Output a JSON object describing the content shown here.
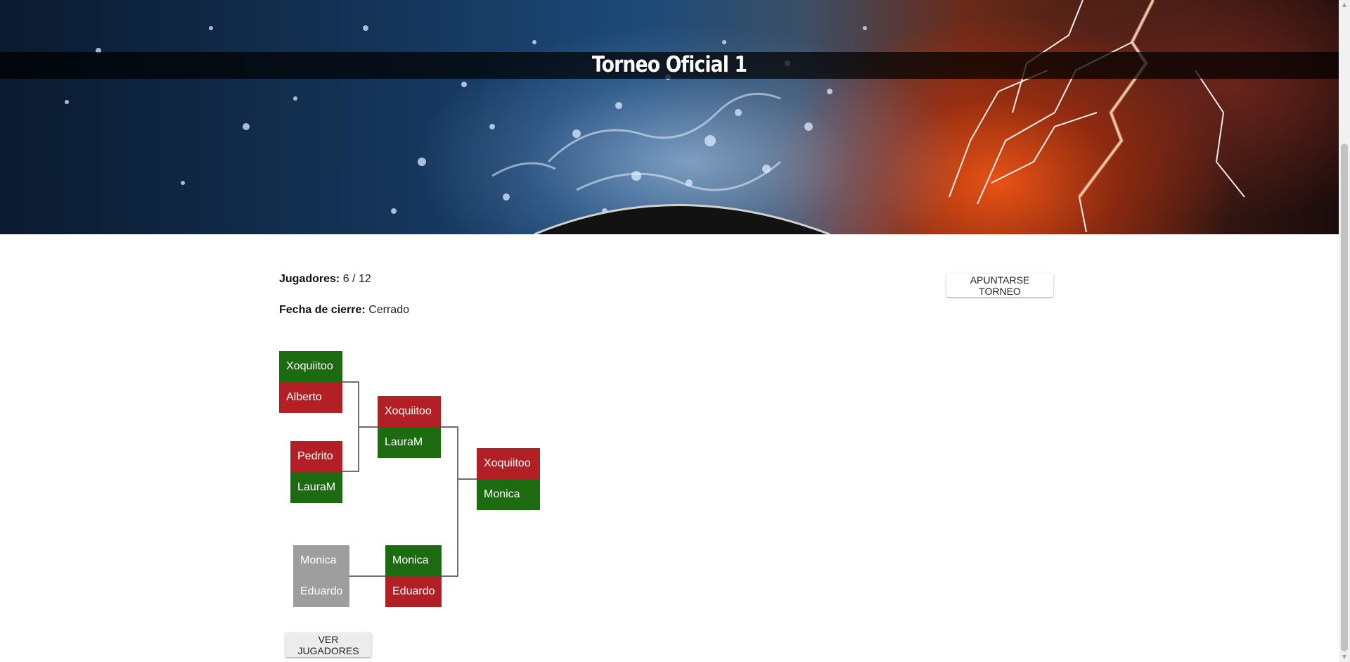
{
  "tournament": {
    "title": "Torneo Oficial 1"
  },
  "info": {
    "players_label": "Jugadores:",
    "players_value": "6 / 12",
    "close_label": "Fecha de cierre:",
    "close_value": "Cerrado"
  },
  "buttons": {
    "join_label": "APUNTARSE TORNEO",
    "view_players_label": "VER JUGADORES"
  },
  "colors": {
    "winner": "#1d6b11",
    "loser": "#b22025",
    "bye": "#9e9e9e"
  },
  "bracket": {
    "round1": [
      {
        "p1": {
          "name": "Xoquiitoo",
          "status": "win"
        },
        "p2": {
          "name": "Alberto",
          "status": "lose"
        }
      },
      {
        "p1": {
          "name": "Pedrito",
          "status": "lose"
        },
        "p2": {
          "name": "LauraM",
          "status": "win"
        }
      },
      {
        "p1": {
          "name": "Monica",
          "status": "bye"
        },
        "p2": {
          "name": "Eduardo",
          "status": "bye"
        }
      }
    ],
    "round2": [
      {
        "p1": {
          "name": "Xoquiitoo",
          "status": "lose"
        },
        "p2": {
          "name": "LauraM",
          "status": "win"
        }
      },
      {
        "p1": {
          "name": "Monica",
          "status": "win"
        },
        "p2": {
          "name": "Eduardo",
          "status": "lose"
        }
      }
    ],
    "final": [
      {
        "p1": {
          "name": "Xoquiitoo",
          "status": "lose"
        },
        "p2": {
          "name": "Monica",
          "status": "win"
        }
      }
    ]
  }
}
